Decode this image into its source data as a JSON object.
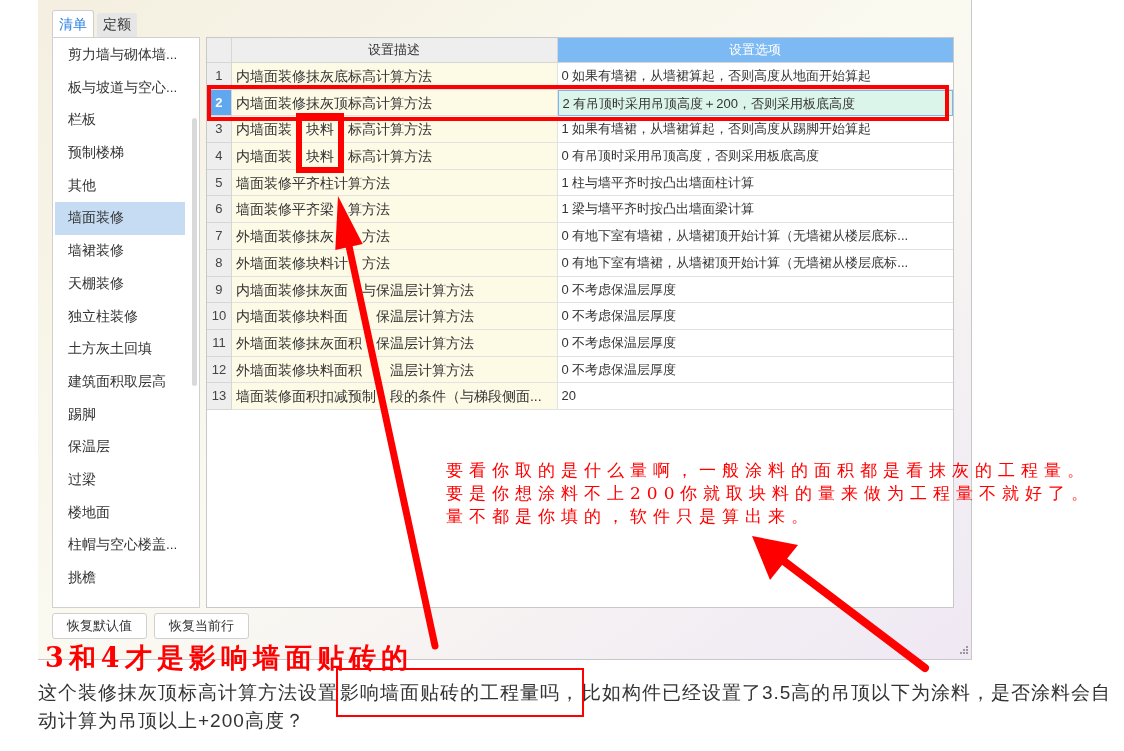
{
  "tabs": [
    {
      "label": "清单",
      "selected": true
    },
    {
      "label": "定额",
      "selected": false
    }
  ],
  "sidebar": {
    "items": [
      {
        "label": "剪力墙与砌体墙...",
        "selected": false
      },
      {
        "label": "板与坡道与空心...",
        "selected": false
      },
      {
        "label": "栏板",
        "selected": false
      },
      {
        "label": "预制楼梯",
        "selected": false
      },
      {
        "label": "其他",
        "selected": false
      },
      {
        "label": "墙面装修",
        "selected": true
      },
      {
        "label": "墙裙装修",
        "selected": false
      },
      {
        "label": "天棚装修",
        "selected": false
      },
      {
        "label": "独立柱装修",
        "selected": false
      },
      {
        "label": "土方灰土回填",
        "selected": false
      },
      {
        "label": "建筑面积取层高",
        "selected": false
      },
      {
        "label": "踢脚",
        "selected": false
      },
      {
        "label": "保温层",
        "selected": false
      },
      {
        "label": "过梁",
        "selected": false
      },
      {
        "label": "楼地面",
        "selected": false
      },
      {
        "label": "柱帽与空心楼盖...",
        "selected": false
      },
      {
        "label": "挑檐",
        "selected": false
      }
    ]
  },
  "table": {
    "columns": [
      "设置描述",
      "设置选项"
    ],
    "rows": [
      {
        "number": "1",
        "description": "内墙面装修抹灰底标高计算方法",
        "option": "0 如果有墙裙，从墙裙算起，否则高度从地面开始算起",
        "selected": false
      },
      {
        "number": "2",
        "description": "内墙面装修抹灰顶标高计算方法",
        "option": "2 有吊顶时采用吊顶高度＋200，否则采用板底高度",
        "selected": true
      },
      {
        "number": "3",
        "description": "内墙面装　块料　标高计算方法",
        "option": "1 如果有墙裙，从墙裙算起，否则高度从踢脚开始算起",
        "selected": false
      },
      {
        "number": "4",
        "description": "内墙面装　块料　标高计算方法",
        "option": "0 有吊顶时采用吊顶高度，否则采用板底高度",
        "selected": false
      },
      {
        "number": "5",
        "description": "墙面装修平齐柱计算方法",
        "option": "1 柱与墙平齐时按凸出墙面柱计算",
        "selected": false
      },
      {
        "number": "6",
        "description": "墙面装修平齐梁　算方法",
        "option": "1 梁与墙平齐时按凸出墙面梁计算",
        "selected": false
      },
      {
        "number": "7",
        "description": "外墙面装修抹灰　　方法",
        "option": "0 有地下室有墙裙，从墙裙顶开始计算（无墙裙从楼层底标...",
        "selected": false
      },
      {
        "number": "8",
        "description": "外墙面装修块料计　方法",
        "option": "0 有地下室有墙裙，从墙裙顶开始计算（无墙裙从楼层底标...",
        "selected": false
      },
      {
        "number": "9",
        "description": "内墙面装修抹灰面　与保温层计算方法",
        "option": "0 不考虑保温层厚度",
        "selected": false
      },
      {
        "number": "10",
        "description": "内墙面装修块料面　　保温层计算方法",
        "option": "0 不考虑保温层厚度",
        "selected": false
      },
      {
        "number": "11",
        "description": "外墙面装修抹灰面积　保温层计算方法",
        "option": "0 不考虑保温层厚度",
        "selected": false
      },
      {
        "number": "12",
        "description": "外墙面装修块料面积　　温层计算方法",
        "option": "0 不考虑保温层厚度",
        "selected": false
      },
      {
        "number": "13",
        "description": "墙面装修面积扣减预制　段的条件（与梯段侧面...",
        "option": "20",
        "selected": false
      }
    ]
  },
  "buttons": [
    "恢复默认值",
    "恢复当前行"
  ],
  "annotations": {
    "left_note": "3和4才是影响墙面贴砖的",
    "right_note": [
      "要看你取的是什么量啊，一般涂料的面积都是看抹灰的工程量。",
      "要是你想涂料不上200你就取块料的量来做为工程量不就好了。",
      "量不都是你填的，软件只是算出来。"
    ]
  },
  "question": {
    "before": "这个装修抹灰顶标高计算方法设置",
    "highlighted": "影响墙面贴砖的工程量吗，",
    "after": "比如构件已经设置了3.5高的吊顶以下为涂料，是否涂料会自动计算为吊顶以上+200高度？"
  }
}
